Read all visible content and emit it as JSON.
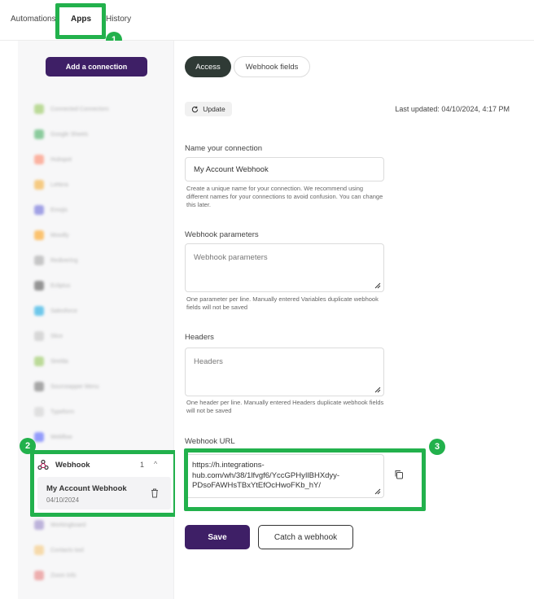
{
  "tabs": [
    {
      "label": "Automations",
      "active": false
    },
    {
      "label": "Apps",
      "active": true
    },
    {
      "label": "History",
      "active": false
    }
  ],
  "callouts": [
    "1",
    "2",
    "3"
  ],
  "sidebar": {
    "add_connection_label": "Add a connection",
    "blurred_items": [
      {
        "label": "Connected Connectors",
        "count": "",
        "color": "#8bc34a"
      },
      {
        "label": "Google Sheets",
        "count": "",
        "color": "#34a853"
      },
      {
        "label": "Hubspot",
        "count": "",
        "color": "#ff7a59"
      },
      {
        "label": "Lettera",
        "count": "",
        "color": "#f5a623"
      },
      {
        "label": "Emojis",
        "count": "",
        "color": "#5b5bd6"
      },
      {
        "label": "Moodly",
        "count": "",
        "color": "#ff9800"
      },
      {
        "label": "Redivering",
        "count": "",
        "color": "#9e9e9e"
      },
      {
        "label": "Ecliptus",
        "count": "",
        "color": "#444444"
      },
      {
        "label": "Salesforce",
        "count": "",
        "color": "#00a1e0"
      },
      {
        "label": "Slice",
        "count": "",
        "color": "#bdbdbd"
      },
      {
        "label": "Sirelda",
        "count": "",
        "color": "#8bc34a"
      },
      {
        "label": "Sourceapper Menu",
        "count": "",
        "color": "#666666"
      },
      {
        "label": "Typeform",
        "count": "",
        "color": "#cccccc"
      },
      {
        "label": "Webflow",
        "count": "",
        "color": "#4353ff"
      }
    ],
    "blurred_items_below": [
      {
        "label": "Workingboard",
        "count": "",
        "color": "#8e7cc3"
      },
      {
        "label": "Contacts tool",
        "count": "",
        "color": "#f6c26b"
      },
      {
        "label": "Zoom Info",
        "count": "",
        "color": "#e57373"
      }
    ],
    "webhook": {
      "name": "Webhook",
      "count": "1",
      "chevron": "^",
      "item_title": "My Account Webhook",
      "item_date": "04/10/2024"
    }
  },
  "main": {
    "tabs": [
      {
        "label": "Access",
        "active": true
      },
      {
        "label": "Webhook fields",
        "active": false
      }
    ],
    "update_label": "Update",
    "last_updated": "Last updated: 04/10/2024, 4:17 PM",
    "name_label": "Name your connection",
    "name_value": "My Account Webhook",
    "name_help": "Create a unique name for your connection. We recommend using different names for your connections to avoid confusion. You can change this later.",
    "params_label": "Webhook parameters",
    "params_placeholder": "Webhook parameters",
    "params_help": "One parameter per line. Manually entered Variables duplicate webhook fields will not be saved",
    "headers_label": "Headers",
    "headers_placeholder": "Headers",
    "headers_help": "One header per line. Manually entered Headers duplicate webhook fields will not be saved",
    "url_label": "Webhook URL",
    "url_value": "https://h.integrations-hub.com/wh/38/1lfvgf6/YccGPHyIlBHXdyy-PDsoFAWHsTBxYtEfOcHwoFKb_hY/",
    "save_label": "Save",
    "catch_label": "Catch a webhook"
  },
  "colors": {
    "accent": "#3e1f66",
    "highlight": "#22b14c",
    "active_tab": "#2f3a35"
  },
  "icons": [
    "webhook-icon",
    "trash-icon",
    "refresh-icon",
    "copy-icon",
    "resize-grip-icon",
    "chevron-up-icon"
  ]
}
